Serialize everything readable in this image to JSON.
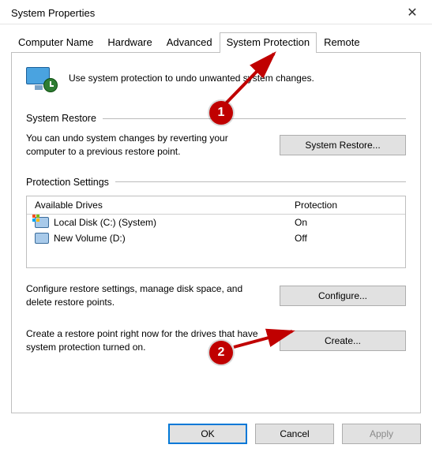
{
  "window": {
    "title": "System Properties"
  },
  "tabs": {
    "computer_name": "Computer Name",
    "hardware": "Hardware",
    "advanced": "Advanced",
    "system_protection": "System Protection",
    "remote": "Remote"
  },
  "intro": "Use system protection to undo unwanted system changes.",
  "groups": {
    "restore_header": "System Restore",
    "restore_text": "You can undo system changes by reverting your computer to a previous restore point.",
    "restore_button": "System Restore...",
    "protection_header": "Protection Settings",
    "drives_header_name": "Available Drives",
    "drives_header_prot": "Protection",
    "drives": [
      {
        "name": "Local Disk (C:) (System)",
        "protection": "On",
        "system": true
      },
      {
        "name": "New Volume (D:)",
        "protection": "Off",
        "system": false
      }
    ],
    "configure_text": "Configure restore settings, manage disk space, and delete restore points.",
    "configure_button": "Configure...",
    "create_text": "Create a restore point right now for the drives that have system protection turned on.",
    "create_button": "Create..."
  },
  "buttons": {
    "ok": "OK",
    "cancel": "Cancel",
    "apply": "Apply"
  },
  "annotations": {
    "badge1": "1",
    "badge2": "2"
  }
}
